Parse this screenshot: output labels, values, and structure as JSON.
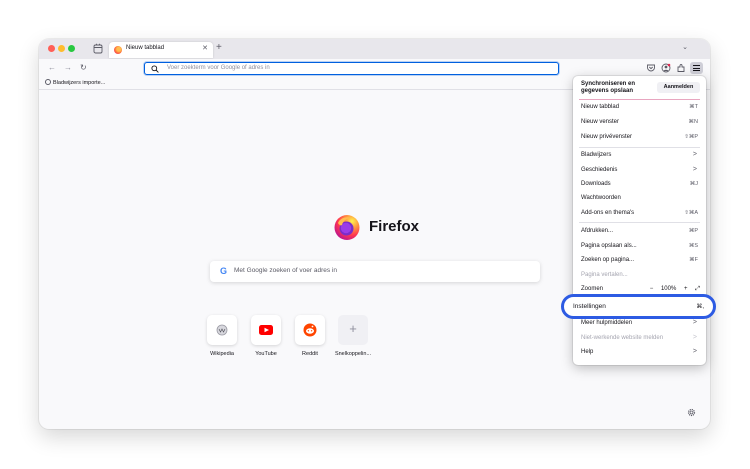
{
  "colors": {
    "accent": "#0060df",
    "highlight": "#2d5be3",
    "menu_button": "#cfcfd8"
  },
  "tab": {
    "title": "Nieuw tabblad",
    "close_icon": "close-icon"
  },
  "newtab": {
    "label": "+"
  },
  "navbar": {
    "back": "←",
    "forward": "→",
    "reload": "↻",
    "url_placeholder": "Voer zoekterm voor Google of adres in"
  },
  "bookmarks": {
    "item": "Bladwijzers importe..."
  },
  "content": {
    "brand": "Firefox",
    "search_placeholder": "Met Google zoeken of voer adres in",
    "google_letter": "G",
    "shortcuts": [
      {
        "label": "Wikipedia"
      },
      {
        "label": "YouTube"
      },
      {
        "label": "Reddit"
      },
      {
        "label": "Snelkoppelin...",
        "plus": "+"
      }
    ]
  },
  "menu": {
    "sync_title": "Synchroniseren en gegevens opslaan",
    "signin": "Aanmelden",
    "items": [
      {
        "label": "Nieuw tabblad",
        "shortcut": "⌘T"
      },
      {
        "label": "Nieuw venster",
        "shortcut": "⌘N"
      },
      {
        "label": "Nieuw privévenster",
        "shortcut": "⇧⌘P"
      },
      {
        "label": "Bladwijzers",
        "arrow": ">"
      },
      {
        "label": "Geschiedenis",
        "arrow": ">"
      },
      {
        "label": "Downloads",
        "shortcut": "⌘J"
      },
      {
        "label": "Wachtwoorden"
      },
      {
        "label": "Add-ons en thema's",
        "shortcut": "⇧⌘A"
      },
      {
        "label": "Afdrukken...",
        "shortcut": "⌘P"
      },
      {
        "label": "Pagina opslaan als...",
        "shortcut": "⌘S"
      },
      {
        "label": "Zoeken op pagina...",
        "shortcut": "⌘F"
      },
      {
        "label": "Pagina vertalen..."
      },
      {
        "label": "Zoomen"
      },
      {
        "label": "Instellingen",
        "shortcut": "⌘,"
      },
      {
        "label": "Meer hulpmiddelen",
        "arrow": ">"
      },
      {
        "label": "Niet-werkende website melden",
        "arrow": ">"
      },
      {
        "label": "Help",
        "arrow": ">"
      }
    ],
    "zoom": {
      "minus": "−",
      "value": "100%",
      "plus": "+",
      "fullscreen": "⤢"
    }
  }
}
